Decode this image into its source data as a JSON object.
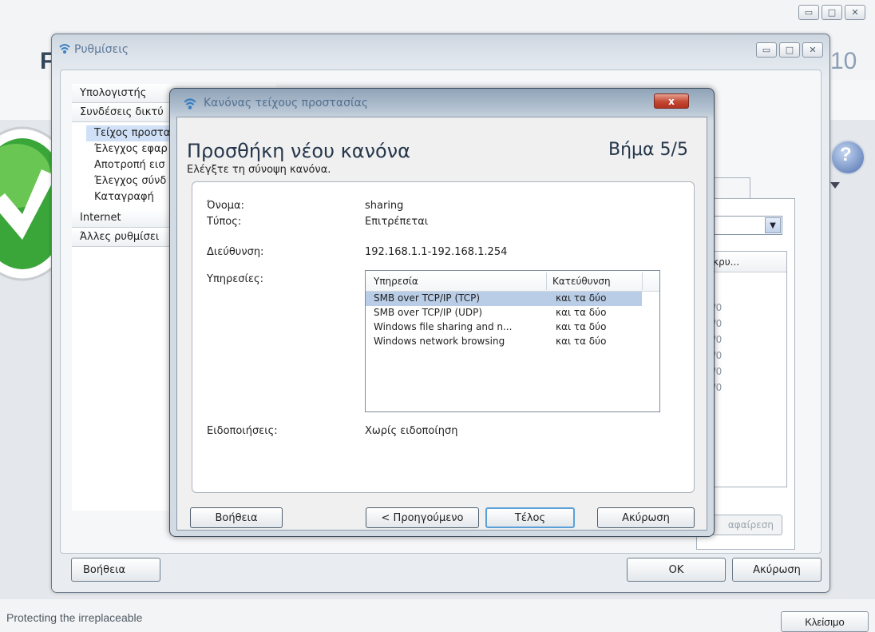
{
  "app": {
    "title_letter": "F",
    "year_fragment": "10",
    "tagline": "Protecting the irreplaceable",
    "close_label": "Κλείσιμο"
  },
  "settings": {
    "title": "Ρυθμίσεις",
    "nav": {
      "computer": "Υπολογιστής",
      "network": "Συνδέσεις δικτύ",
      "items": [
        "Τείχος προστα",
        "Έλεγχος εφαρ",
        "Αποτροπή εισ",
        "Έλεγχος σύνδ",
        "Καταγραφή"
      ],
      "internet": "Internet",
      "other": "Άλλες ρυθμίσει"
    },
    "right_tab_label": "ς",
    "right_list_header": "κρυ...",
    "right_list_values": [
      "0/0",
      "0/0",
      "0/0",
      "0/0",
      "0/0",
      "0/0"
    ],
    "right_button_label": "αφαίρεση",
    "help_label": "Βοήθεια",
    "ok_label": "OK",
    "cancel_label": "Ακύρωση"
  },
  "dialog": {
    "title": "Κανόνας τείχους προστασίας",
    "close_label": "x",
    "heading": "Προσθήκη νέου κανόνα",
    "step": "Βήμα 5/5",
    "subtitle": "Ελέγξτε τη σύνοψη κανόνα.",
    "fields": {
      "name_label": "Όνομα:",
      "name_value": "sharing",
      "type_label": "Τύπος:",
      "type_value": "Επιτρέπεται",
      "address_label": "Διεύθυνση:",
      "address_value": "192.168.1.1-192.168.1.254",
      "services_label": "Υπηρεσίες:",
      "notifications_label": "Ειδοποιήσεις:",
      "notifications_value": "Χωρίς ειδοποίηση"
    },
    "services_table": {
      "headers": [
        "Υπηρεσία",
        "Κατεύθυνση"
      ],
      "rows": [
        [
          "SMB over TCP/IP (TCP)",
          "και τα δύο"
        ],
        [
          "SMB over TCP/IP (UDP)",
          "και τα δύο"
        ],
        [
          "Windows file sharing and n...",
          "και τα δύο"
        ],
        [
          "Windows network browsing",
          "και τα δύο"
        ]
      ]
    },
    "buttons": {
      "help": "Βοήθεια",
      "back": "< Προηγούμενο",
      "finish": "Τέλος",
      "cancel": "Ακύρωση"
    }
  }
}
